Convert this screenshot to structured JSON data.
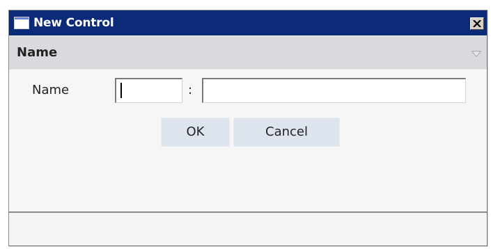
{
  "window": {
    "title": "New Control",
    "icon": "window-icon",
    "close_icon": "close-icon"
  },
  "section": {
    "title": "Name",
    "collapse_icon": "triangle-down-icon"
  },
  "form": {
    "name_label": "Name",
    "separator": ":",
    "first_value": "",
    "second_value": ""
  },
  "buttons": {
    "ok_label": "OK",
    "cancel_label": "Cancel"
  },
  "colors": {
    "titlebar": "#0b2a78",
    "section_header": "#d8dadd",
    "button": "#dde4ee"
  }
}
